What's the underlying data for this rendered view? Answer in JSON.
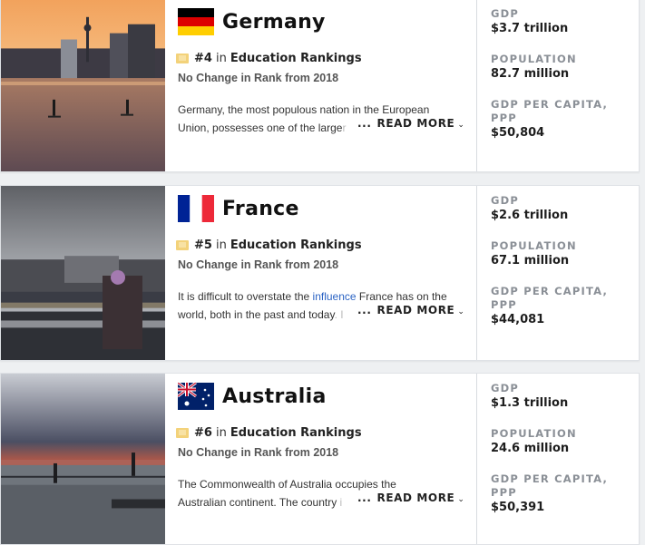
{
  "countries": [
    {
      "name": "Germany",
      "rank": "#4",
      "rank_in": "in",
      "rank_category": "Education Rankings",
      "rank_change": "No Change in Rank from 2018",
      "description_line1": "Germany, the most populous nation in the European",
      "description_line2_visible": "Union, possesses one of the large",
      "description_line2_faded": "r",
      "read_more": "READ MORE",
      "ellipsis": "...",
      "gdp_label": "GDP",
      "gdp": "$3.7 trillion",
      "population_label": "POPULATION",
      "population": "82.7 million",
      "gdp_pc_label": "GDP PER CAPITA, PPP",
      "gdp_pc": "$50,804"
    },
    {
      "name": "France",
      "rank": "#5",
      "rank_in": "in",
      "rank_category": "Education Rankings",
      "rank_change": "No Change in Rank from 2018",
      "description_line1_a": "It is difficult to overstate the ",
      "description_line1_link": "influence",
      "description_line1_b": " France has on the",
      "description_line2_visible": "world, both in the past and today",
      "description_line2_faded": ". I",
      "read_more": "READ MORE",
      "ellipsis": "...",
      "gdp_label": "GDP",
      "gdp": "$2.6 trillion",
      "population_label": "POPULATION",
      "population": "67.1 million",
      "gdp_pc_label": "GDP PER CAPITA, PPP",
      "gdp_pc": "$44,081"
    },
    {
      "name": "Australia",
      "rank": "#6",
      "rank_in": "in",
      "rank_category": "Education Rankings",
      "rank_change": "No Change in Rank from 2018",
      "description_line1": "The Commonwealth of Australia occupies the",
      "description_line2_visible": "Australian continent. The country",
      "description_line2_faded": " i",
      "read_more": "READ MORE",
      "ellipsis": "...",
      "gdp_label": "GDP",
      "gdp": "$1.3 trillion",
      "population_label": "POPULATION",
      "population": "24.6 million",
      "gdp_pc_label": "GDP PER CAPITA, PPP",
      "gdp_pc": "$50,391"
    }
  ],
  "icons": {
    "badge": "ranking-badge-icon",
    "chevron": "chevron-down-icon"
  },
  "colors": {
    "badge": "#f3d27a",
    "link": "#2b63c4",
    "stat_label": "#8a8f96"
  }
}
